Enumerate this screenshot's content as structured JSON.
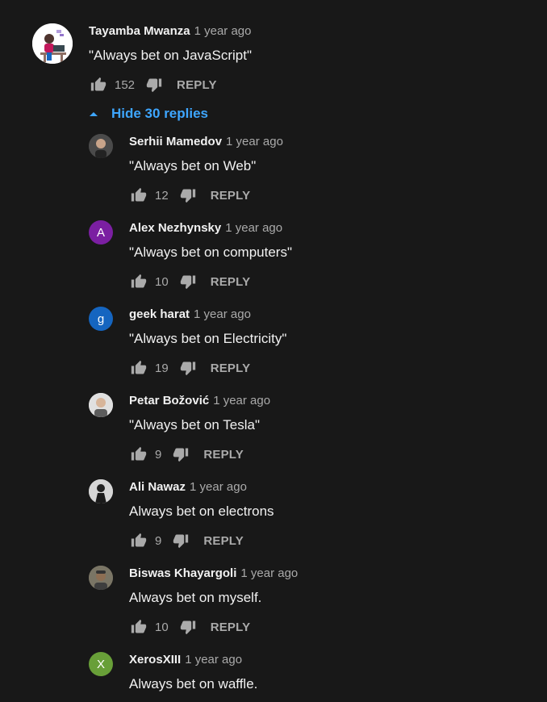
{
  "thread": {
    "top_comment": {
      "author": "Tayamba Mwanza",
      "time": "1 year ago",
      "text": "\"Always bet on JavaScript\"",
      "likes": "152",
      "reply_label": "REPLY",
      "avatar_icon": "person-at-laptop-icon"
    },
    "toggle_label": "Hide 30 replies",
    "toggle_color": "#3ea6ff"
  },
  "replies": [
    {
      "author": "Serhii Mamedov",
      "time": "1 year ago",
      "text": "\"Always bet on Web\"",
      "likes": "12",
      "reply_label": "REPLY",
      "avatar_icon": "photo-avatar-icon"
    },
    {
      "author": "Alex Nezhynsky",
      "time": "1 year ago",
      "text": "\"Always bet on computers\"",
      "likes": "10",
      "reply_label": "REPLY",
      "avatar_letter": "A",
      "avatar_color": "#7b1fa2"
    },
    {
      "author": "geek harat",
      "time": "1 year ago",
      "text": "\"Always bet on Electricity\"",
      "likes": "19",
      "reply_label": "REPLY",
      "avatar_letter": "g",
      "avatar_color": "#1565c0"
    },
    {
      "author": "Petar Božović",
      "time": "1 year ago",
      "text": "\"Always bet on Tesla\"",
      "likes": "9",
      "reply_label": "REPLY",
      "avatar_icon": "photo-avatar-icon"
    },
    {
      "author": "Ali Nawaz",
      "time": "1 year ago",
      "text": "Always bet on electrons",
      "likes": "9",
      "reply_label": "REPLY",
      "avatar_icon": "photo-avatar-icon"
    },
    {
      "author": "Biswas Khayargoli",
      "time": "1 year ago",
      "text": "Always bet on myself.",
      "likes": "10",
      "reply_label": "REPLY",
      "avatar_icon": "photo-avatar-icon"
    },
    {
      "author": "XerosXIII",
      "time": "1 year ago",
      "text": "Always bet on waffle.",
      "avatar_letter": "X",
      "avatar_color": "#689f38"
    }
  ],
  "colors": {
    "background": "#181818",
    "primary_text": "#f1f1f1",
    "secondary_text": "#aaaaaa",
    "link": "#3ea6ff"
  }
}
